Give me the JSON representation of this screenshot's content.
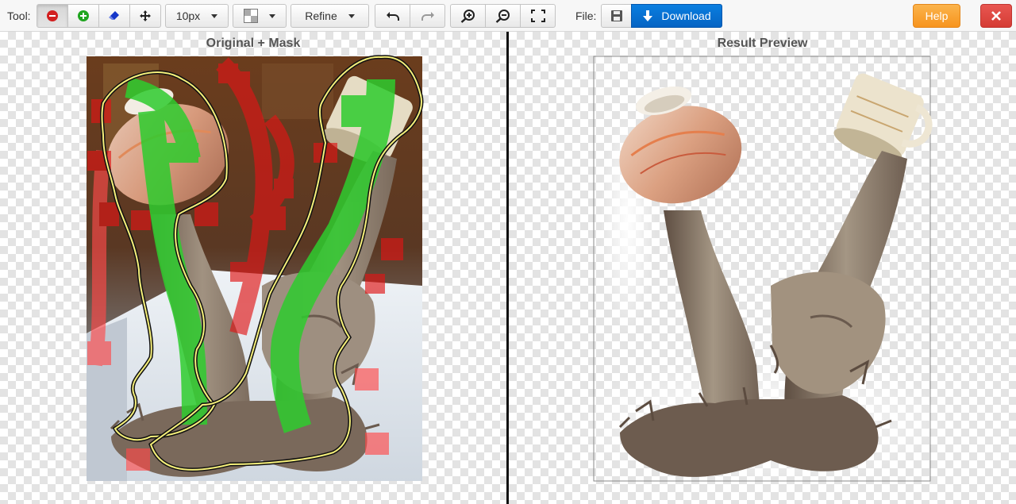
{
  "toolbar": {
    "tool_label": "Tool:",
    "brush_size": "10px",
    "refine_label": "Refine",
    "file_label": "File:",
    "download_label": "Download",
    "help_label": "Help"
  },
  "panels": {
    "left_title": "Original + Mask",
    "right_title": "Result Preview"
  },
  "colors": {
    "remove_red": "#d21f1f",
    "keep_green": "#2ecc2e",
    "accent_blue": "#0564c4",
    "help_orange": "#f7941e",
    "close_red": "#d53c35"
  },
  "icons": [
    "minus-circle-icon",
    "plus-circle-icon",
    "eraser-icon",
    "move-icon",
    "background-swatch-icon",
    "undo-icon",
    "redo-icon",
    "zoom-in-icon",
    "zoom-out-icon",
    "fullscreen-icon",
    "save-icon",
    "download-icon",
    "close-icon"
  ]
}
